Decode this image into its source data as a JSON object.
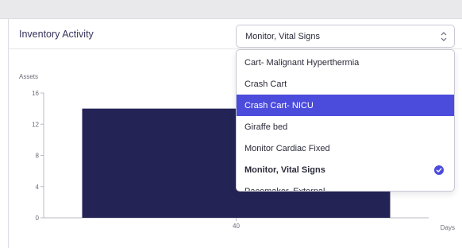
{
  "card": {
    "title": "Inventory Activity"
  },
  "asset_select": {
    "value": "Monitor, Vital Signs",
    "options": [
      "Cart- Malignant Hyperthermia",
      "Crash Cart",
      "Crash Cart- NICU",
      "Giraffe bed",
      "Monitor Cardiac Fixed",
      "Monitor, Vital Signs",
      "Pacemaker, External"
    ],
    "highlighted_index": 2,
    "selected_index": 5
  },
  "colors": {
    "accent": "#4b4bdc",
    "bar": "#232356"
  },
  "chart_data": {
    "type": "bar",
    "categories": [
      "40"
    ],
    "values": [
      14
    ],
    "xlabel": "Days",
    "ylabel": "Assets",
    "ylim": [
      0,
      16
    ],
    "yticks": [
      0,
      4,
      8,
      12,
      16
    ],
    "grid": false
  }
}
